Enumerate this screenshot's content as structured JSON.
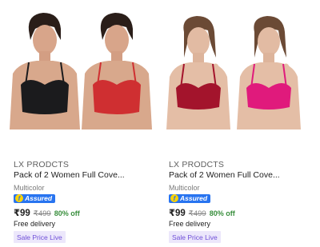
{
  "products": [
    {
      "brand": "LX PRODCTS",
      "title": "Pack of 2 Women Full Cove...",
      "variant": "Multicolor",
      "assured_label": "Assured",
      "price": "₹99",
      "mrp": "₹499",
      "discount": "80% off",
      "delivery": "Free delivery",
      "sale_tag": "Sale Price Live",
      "colors": {
        "left": "#1b1b1d",
        "right": "#cf2f31"
      }
    },
    {
      "brand": "LX PRODCTS",
      "title": "Pack of 2 Women Full Cove...",
      "variant": "Multicolor",
      "assured_label": "Assured",
      "price": "₹99",
      "mrp": "₹499",
      "discount": "80% off",
      "delivery": "Free delivery",
      "sale_tag": "Sale Price Live",
      "colors": {
        "left": "#a3142c",
        "right": "#e01a7c"
      }
    }
  ],
  "theme": {
    "accent_blue": "#2874f0",
    "discount_green": "#388e3c",
    "sale_tag_bg": "#ece7fb",
    "sale_tag_text": "#6f4fd8"
  }
}
